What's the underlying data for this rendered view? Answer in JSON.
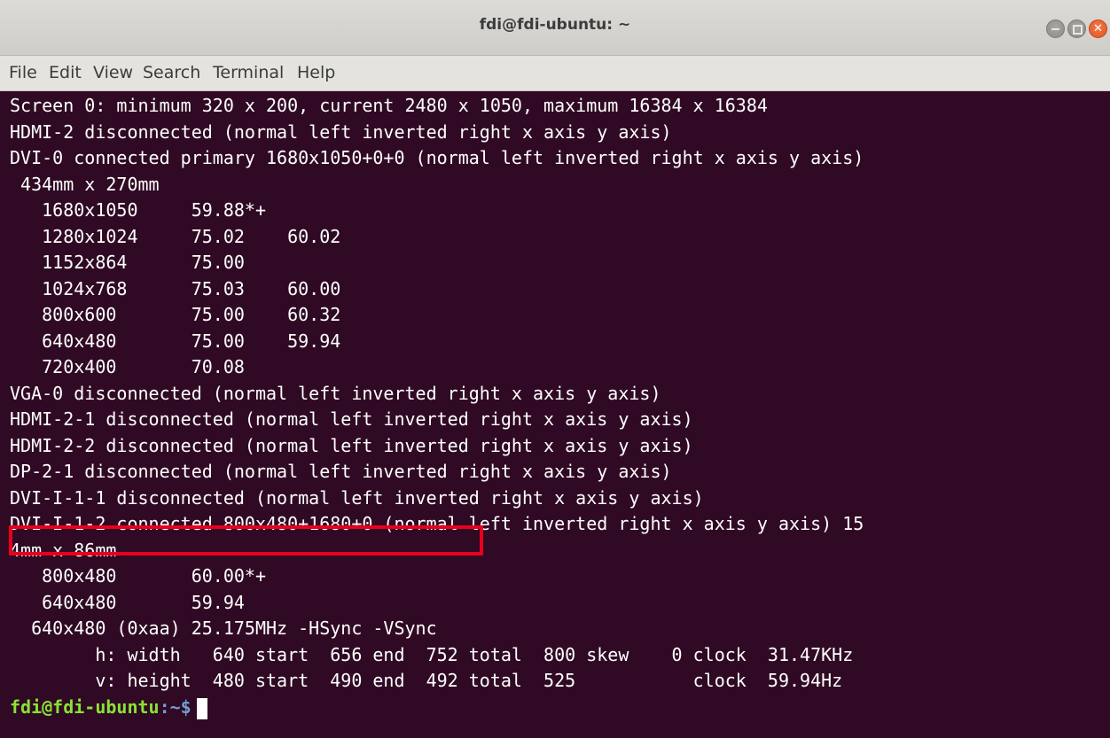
{
  "window": {
    "title": "fdi@fdi-ubuntu: ~"
  },
  "menu": [
    "File",
    "Edit",
    "View",
    "Search",
    "Terminal",
    "Help"
  ],
  "terminal": {
    "lines": [
      "Screen 0: minimum 320 x 200, current 2480 x 1050, maximum 16384 x 16384",
      "HDMI-2 disconnected (normal left inverted right x axis y axis)",
      "DVI-0 connected primary 1680x1050+0+0 (normal left inverted right x axis y axis)",
      " 434mm x 270mm",
      "   1680x1050     59.88*+",
      "   1280x1024     75.02    60.02",
      "   1152x864      75.00",
      "   1024x768      75.03    60.00",
      "   800x600       75.00    60.32",
      "   640x480       75.00    59.94",
      "   720x400       70.08",
      "VGA-0 disconnected (normal left inverted right x axis y axis)",
      "HDMI-2-1 disconnected (normal left inverted right x axis y axis)",
      "HDMI-2-2 disconnected (normal left inverted right x axis y axis)",
      "DP-2-1 disconnected (normal left inverted right x axis y axis)",
      "DVI-I-1-1 disconnected (normal left inverted right x axis y axis)",
      "DVI-I-1-2 connected 800x480+1680+0 (normal left inverted right x axis y axis) 15",
      "4mm x 86mm",
      "   800x480       60.00*+",
      "   640x480       59.94",
      "  640x480 (0xaa) 25.175MHz -HSync -VSync",
      "        h: width   640 start  656 end  752 total  800 skew    0 clock  31.47KHz",
      "        v: height  480 start  490 end  492 total  525           clock  59.94Hz"
    ],
    "prompt_user": "fdi@fdi-ubuntu",
    "prompt_path": ":~$"
  },
  "colors": {
    "background": "#300a24",
    "text": "#ffffff",
    "prompt_user": "#8ae234",
    "prompt_path": "#729fcf",
    "highlight": "#e8001c"
  }
}
